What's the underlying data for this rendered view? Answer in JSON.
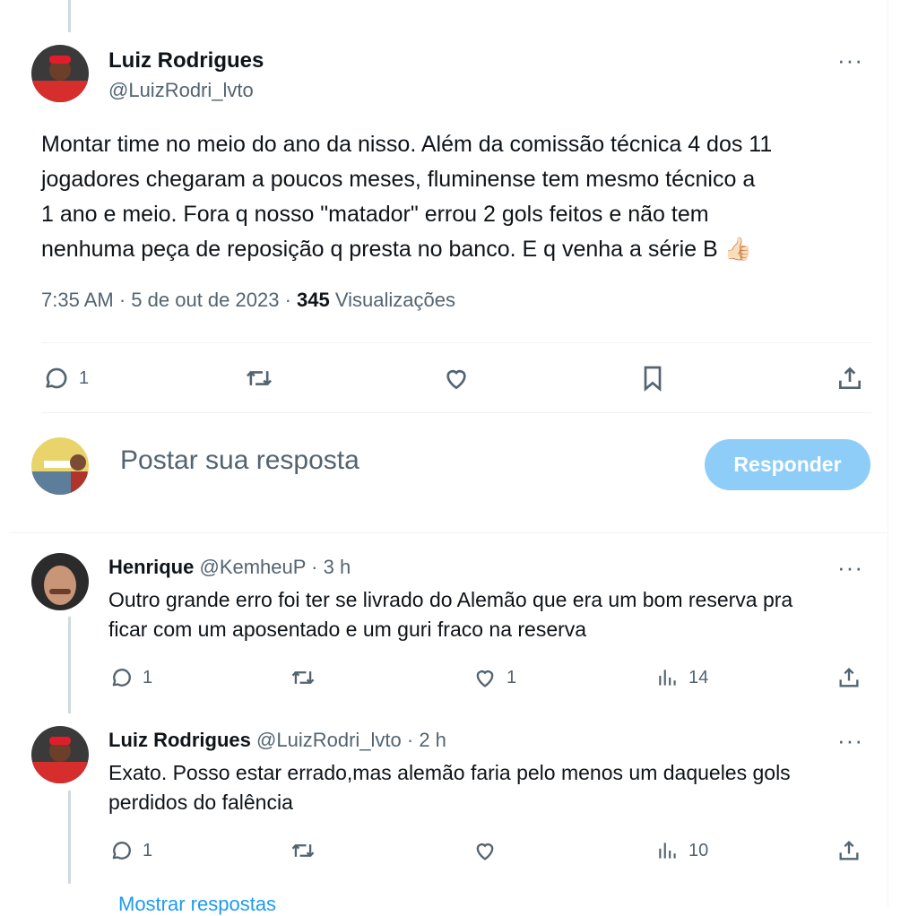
{
  "main_tweet": {
    "author_name": "Luiz Rodrigues",
    "author_handle": "@LuizRodri_lvto",
    "text_lines": [
      "Montar time no meio do ano da nisso. Além da comissão técnica 4 dos 11",
      "jogadores chegaram a poucos meses, fluminense tem mesmo técnico a",
      "1 ano e meio. Fora q nosso \"matador\" errou 2 gols feitos e não tem",
      "nenhuma peça de reposição q presta no banco. E q venha a série B 👍🏻"
    ],
    "time": "7:35 AM",
    "date": "5 de out de 2023",
    "separator": "·",
    "views_count": "345",
    "views_label": "Visualizações",
    "reply_count": "1"
  },
  "compose": {
    "placeholder": "Postar sua resposta",
    "button_label": "Responder"
  },
  "replies": [
    {
      "name": "Henrique",
      "handle": "@KemheuP",
      "time": "· 3 h",
      "text_lines": [
        "Outro grande erro foi ter se livrado do Alemão que era um bom reserva pra",
        "ficar com um aposentado e um guri fraco na reserva"
      ],
      "reply_count": "1",
      "like_count": "1",
      "views": "14"
    },
    {
      "name": "Luiz Rodrigues",
      "handle": "@LuizRodri_lvto",
      "time": "· 2 h",
      "text_lines": [
        "Exato. Posso estar errado,mas alemão faria pelo menos um daqueles gols",
        "perdidos do falência"
      ],
      "reply_count": "1",
      "like_count": "",
      "views": "10"
    }
  ],
  "show_replies": "Mostrar respostas",
  "more_icon_label": "···",
  "colors": {
    "accent": "#1d9bf0",
    "reply_button_disabled": "#8ecdf8",
    "secondary_text": "#536471",
    "thread_line": "#cfd9de"
  },
  "icons": [
    "reply-icon",
    "retweet-icon",
    "like-icon",
    "bookmark-icon",
    "share-icon",
    "views-icon",
    "more-icon"
  ]
}
